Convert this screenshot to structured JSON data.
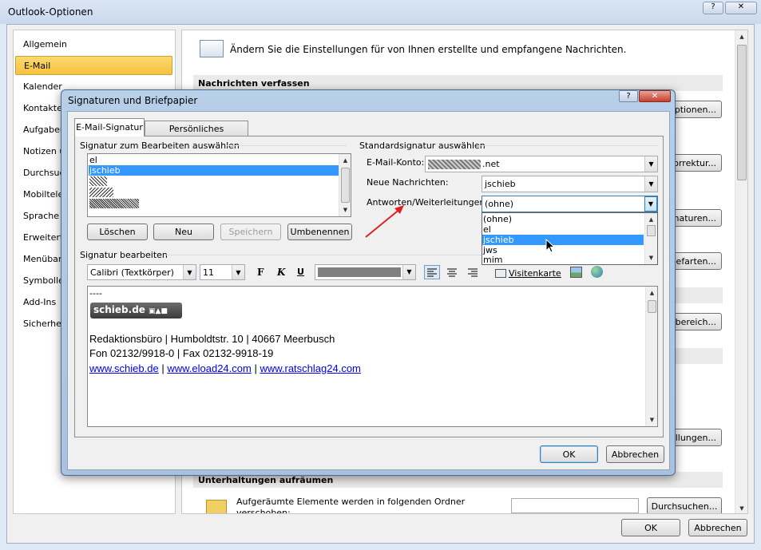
{
  "outer": {
    "title": "Outlook-Optionen",
    "nav": [
      "Allgemein",
      "E-Mail",
      "Kalender",
      "Kontakte",
      "Aufgaben",
      "Notizen u",
      "Durchsuc",
      "Mobiltele",
      "Sprache",
      "Erweitert",
      "Menüband",
      "Symbollei",
      "Add-Ins",
      "Sicherhei"
    ],
    "header_text": "Ändern Sie die Einstellungen für von Ihnen erstellte und empfangene Nachrichten.",
    "section_compose": "Nachrichten verfassen",
    "section_cleanup": "Unterhaltungen aufräumen",
    "right_buttons": [
      "Optionen...",
      "Korrektur...",
      "Signaturen...",
      "Briefarten...",
      "bereich...",
      "llungen..."
    ],
    "cleanup_text_1": "Aufgeräumte Elemente werden in folgenden Ordner",
    "cleanup_text_2": "verschoben:",
    "browse_button": "Durchsuchen...",
    "ok": "OK",
    "cancel": "Abbrechen"
  },
  "dialog": {
    "title": "Signaturen und Briefpapier",
    "tabs": [
      "E-Mail-Signatur",
      "Persönliches Briefpapier"
    ],
    "select_sig_label": "Signatur zum Bearbeiten auswählen",
    "sig_list": [
      "el",
      "jschieb"
    ],
    "buttons": {
      "delete": "Löschen",
      "new": "Neu",
      "save": "Speichern",
      "rename": "Umbenennen"
    },
    "default_sig_label": "Standardsignatur auswählen",
    "account_label": "E-Mail-Konto:",
    "account_value": ".net",
    "new_msgs_label": "Neue Nachrichten:",
    "new_msgs_value": "jschieb",
    "replies_label": "Antworten/Weiterleitungen:",
    "replies_value": "(ohne)",
    "dropdown_options": [
      "(ohne)",
      "el",
      "jschieb",
      "jws",
      "mim"
    ],
    "dropdown_selected": "jschieb",
    "edit_label": "Signatur bearbeiten",
    "font_name": "Calibri (Textkörper)",
    "font_size": "11",
    "bold": "F",
    "italic": "K",
    "underline": "U",
    "business_card": "Visitenkarte",
    "signature": {
      "dashes": "----",
      "logo_text": "schieb.de",
      "line1": "Redaktionsbüro | Humboldtstr. 10 | 40667 Meerbusch",
      "line2": "Fon 02132/9918-0 | Fax 02132-9918-19",
      "link1": "www.schieb.de",
      "link2": "www.eload24.com",
      "link3": "www.ratschlag24.com",
      "sep": " | "
    },
    "ok": "OK",
    "cancel": "Abbrechen",
    "help": "?",
    "close": "✕"
  },
  "colors": {
    "accent_nav": "#fbd96e",
    "selection": "#3399ff",
    "link": "#0000ee",
    "arrow": "#e02020"
  }
}
